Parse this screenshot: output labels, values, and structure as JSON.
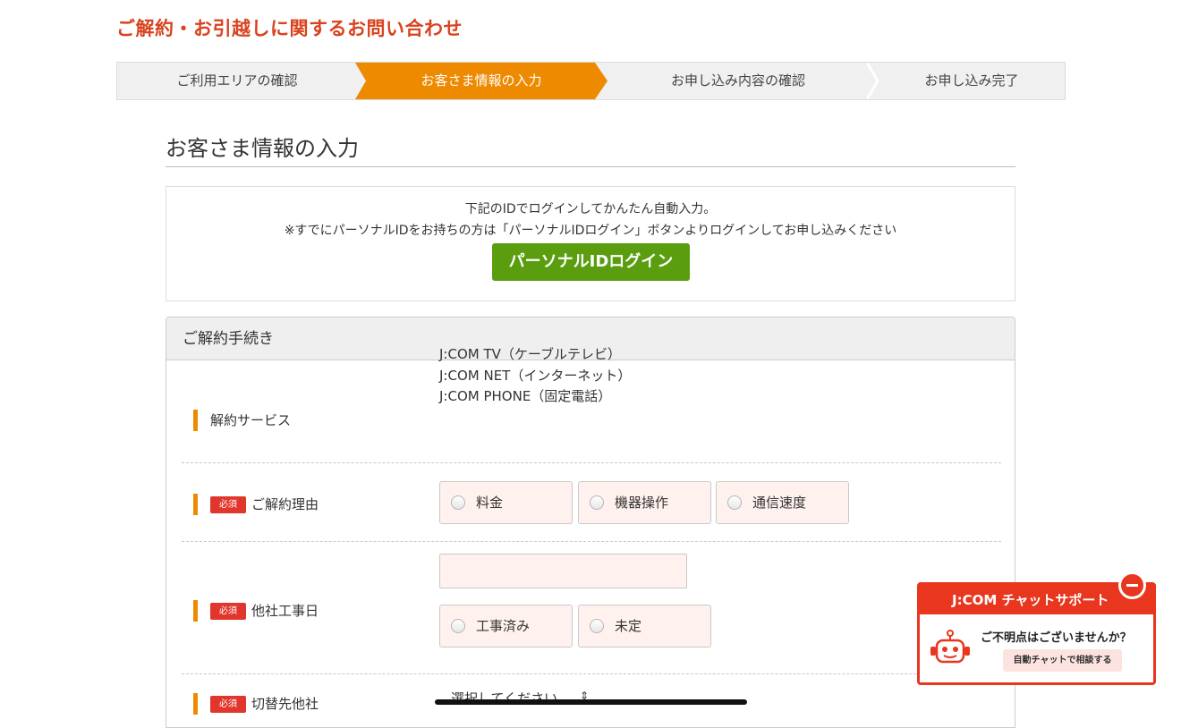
{
  "page": {
    "heading": "ご解約・お引越しに関するお問い合わせ"
  },
  "steps": [
    {
      "label": "ご利用エリアの確認",
      "active": false
    },
    {
      "label": "お客さま情報の入力",
      "active": true
    },
    {
      "label": "お申し込み内容の確認",
      "active": false
    },
    {
      "label": "お申し込み完了",
      "active": false
    }
  ],
  "colors": {
    "accent": "#ed8a00",
    "brand_red": "#e8361f",
    "login_green": "#5a9e0f",
    "field_bg": "#fff1ee"
  },
  "section": {
    "title": "お客さま情報の入力"
  },
  "login": {
    "line1": "下記のIDでログインしてかんたん自動入力。",
    "line2": "※すでにパーソナルIDをお持ちの方は「パーソナルIDログイン」ボタンよりログインしてお申し込みください",
    "button_label": "パーソナルIDログイン"
  },
  "form": {
    "panel_title": "ご解約手続き",
    "required_badge": "必須",
    "service": {
      "label": "解約サービス",
      "values": [
        "J:COM TV（ケーブルテレビ）",
        "J:COM NET（インターネット）",
        "J:COM PHONE（固定電話）"
      ]
    },
    "reason": {
      "label": "ご解約理由",
      "options": [
        "料金",
        "機器操作",
        "通信速度"
      ]
    },
    "construction_date": {
      "label": "他社工事日",
      "value": "",
      "options": [
        "工事済み",
        "未定"
      ]
    },
    "switch_carrier": {
      "label": "切替先他社",
      "select_value": "選択してください",
      "caret": "⇕"
    }
  },
  "chat": {
    "title": "J:COM チャットサポート",
    "question": "ご不明点はございませんか？",
    "button_label": "自動チャットで相談する",
    "icons": {
      "close": "minus-circle-icon",
      "robot": "robot-icon"
    }
  }
}
